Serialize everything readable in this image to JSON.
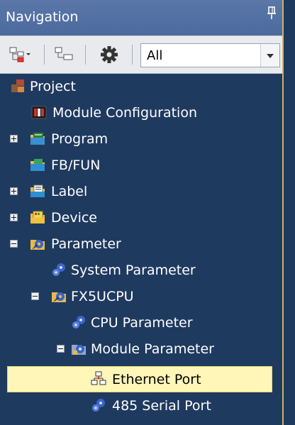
{
  "titlebar": {
    "title": "Navigation",
    "pin_icon": "pin-icon"
  },
  "toolbar": {
    "buttons": [
      "expand-collapse-icon",
      "tree-view-icon",
      "gear-icon"
    ],
    "filter": {
      "value": "All",
      "options_visible": [
        "All"
      ]
    }
  },
  "tree": {
    "nodes": [
      {
        "label": "Project",
        "icon": "project-icon",
        "toggle": "none"
      },
      {
        "label": "Module Configuration",
        "icon": "module-configuration-icon",
        "toggle": "none"
      },
      {
        "label": "Program",
        "icon": "program-folder-icon",
        "toggle": "plus"
      },
      {
        "label": "FB/FUN",
        "icon": "fb-fun-folder-icon",
        "toggle": "none"
      },
      {
        "label": "Label",
        "icon": "label-folder-icon",
        "toggle": "plus"
      },
      {
        "label": "Device",
        "icon": "device-folder-icon",
        "toggle": "plus"
      },
      {
        "label": "Parameter",
        "icon": "parameter-folder-icon",
        "toggle": "minus"
      },
      {
        "label": "System Parameter",
        "icon": "gear-parameter-icon",
        "toggle": "none"
      },
      {
        "label": "FX5UCPU",
        "icon": "cpu-folder-icon",
        "toggle": "minus"
      },
      {
        "label": "CPU Parameter",
        "icon": "gear-parameter-icon",
        "toggle": "none"
      },
      {
        "label": "Module Parameter",
        "icon": "module-parameter-icon",
        "toggle": "minus"
      },
      {
        "label": "Ethernet Port",
        "icon": "network-icon",
        "toggle": "none",
        "selected": true
      },
      {
        "label": "485 Serial Port",
        "icon": "gear-parameter-icon",
        "toggle": "none"
      }
    ]
  },
  "colors": {
    "panel_bg": "#1f3a5f",
    "titlebar": "#5472a4",
    "selected_bg": "#fff6b8",
    "accent_border": "#c9b46a"
  }
}
